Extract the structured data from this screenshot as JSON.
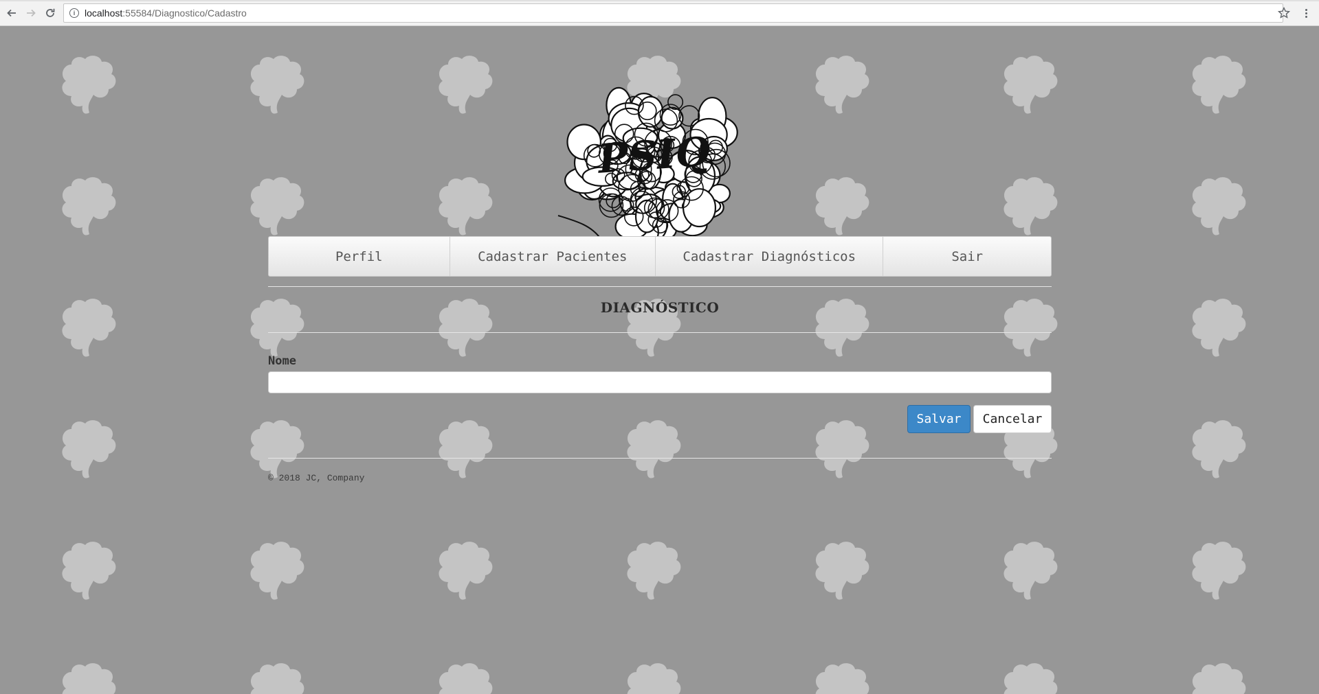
{
  "browser": {
    "url_host": "localhost",
    "url_path": ":55584/Diagnostico/Cadastro",
    "back_icon": "arrow-left-icon",
    "forward_icon": "arrow-right-icon",
    "reload_icon": "reload-icon",
    "info_icon": "info-icon",
    "info_glyph": "i",
    "bookmark_icon": "star-icon",
    "menu_icon": "kebab-menu-icon"
  },
  "logo": {
    "text": "PSIQ"
  },
  "nav": {
    "items": [
      {
        "label": "Perfil"
      },
      {
        "label": "Cadastrar Pacientes"
      },
      {
        "label": "Cadastrar Diagnósticos"
      },
      {
        "label": "Sair"
      }
    ]
  },
  "form": {
    "title": "DIAGNÓSTICO",
    "name_label": "Nome",
    "name_value": "",
    "save_label": "Salvar",
    "cancel_label": "Cancelar"
  },
  "footer": {
    "text": "© 2018 JC, Company"
  },
  "colors": {
    "background": "#979797",
    "primary_button": "#3c88c8",
    "brain_pattern": "#c4c4c4"
  }
}
